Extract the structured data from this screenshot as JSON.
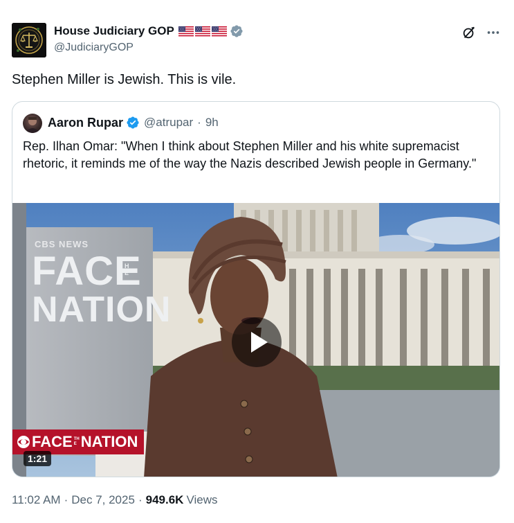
{
  "author": {
    "name": "House Judiciary GOP",
    "handle": "@JudiciaryGOP",
    "flags": [
      "us-flag",
      "us-flag",
      "us-flag"
    ],
    "verified_color": "#829aab"
  },
  "post": {
    "text": "Stephen Miller is Jewish. This is vile."
  },
  "quote": {
    "name": "Aaron Rupar",
    "handle": "@atrupar",
    "separator": "·",
    "time": "9h",
    "verified_color": "#1d9bf0",
    "text": "Rep. Ilhan Omar: \"When I think about Stephen Miller and his white supremacist rhetoric, it reminds me of the way the Nazis described Jewish people in Germany.\"",
    "video": {
      "duration": "1:21",
      "backdrop_cbs": "CBS NEWS",
      "backdrop_face": "FACE",
      "backdrop_the": "THE",
      "backdrop_nation": "NATION",
      "lower_third_face": "FACE",
      "lower_third_the": "THE",
      "lower_third_nation": "NATION"
    }
  },
  "meta": {
    "time": "11:02 AM",
    "sep1": "·",
    "date": "Dec 7, 2025",
    "sep2": "·",
    "views_count": "949.6K",
    "views_label": "Views"
  },
  "icons": {
    "grok": "grok-icon",
    "more": "more-icon",
    "play": "play-icon"
  }
}
